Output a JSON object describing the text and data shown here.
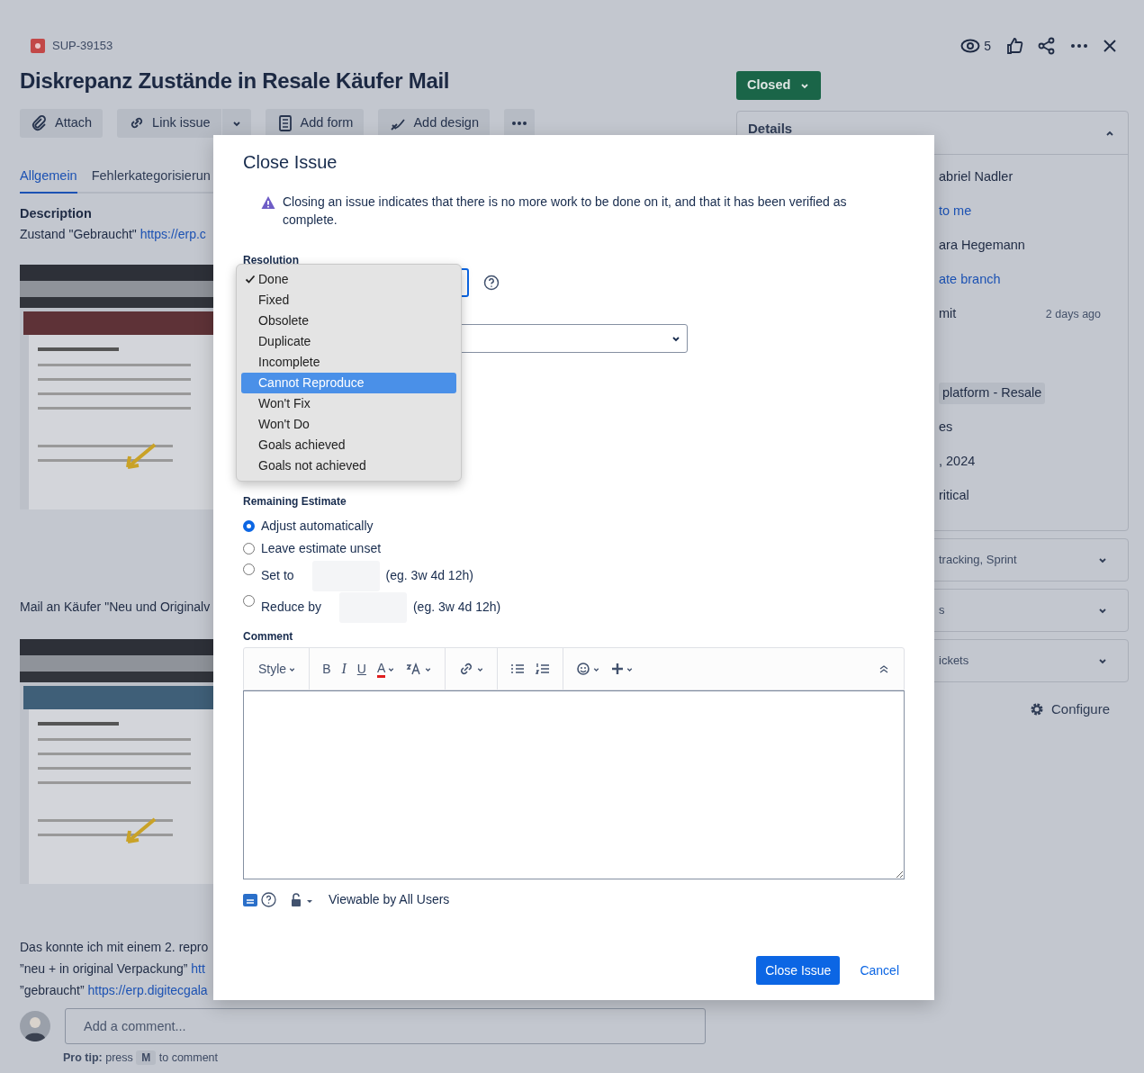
{
  "issue": {
    "key": "SUP-39153",
    "watchers": "5",
    "title": "Diskrepanz Zustände in Resale Käufer Mail",
    "status": "Closed"
  },
  "actions": [
    "Attach",
    "Link issue",
    "Add form",
    "Add design"
  ],
  "tabs": [
    {
      "label": "Allgemein",
      "selected": true
    },
    {
      "label": "Fehlerkategorisierun",
      "selected": false
    }
  ],
  "description": {
    "heading": "Description",
    "content": [
      {
        "kind": "text",
        "text": "Zustand \"Gebraucht\"",
        "link": "https://erp.c"
      },
      {
        "kind": "picture"
      },
      {
        "kind": "text",
        "text": "Mail an Käufer  \"Neu und Originalv"
      },
      {
        "kind": "picture"
      },
      {
        "kind": "text",
        "text": "Das konnte ich mit einem 2. repro"
      },
      {
        "kind": "text",
        "text": "”neu + in original Verpackung”",
        "link": "htt"
      },
      {
        "kind": "text",
        "text": "”gebraucht”",
        "link": "https://erp.digitecgala"
      }
    ]
  },
  "comment_box": {
    "placeholder": "Add a comment...",
    "tip_label": "Pro tip:",
    "tip_text": "press",
    "key": "M",
    "tip_end": "to comment"
  },
  "details": {
    "heading": "Details",
    "rows": [
      {
        "kind": "text",
        "value": "abriel Nadler"
      },
      {
        "kind": "link",
        "value": "to me"
      },
      {
        "kind": "text",
        "value": "ara Hegemann"
      },
      {
        "kind": "link",
        "value": "ate branch"
      },
      {
        "kind": "text",
        "value": "mit",
        "meta": "2 days ago"
      },
      {
        "kind": "tag",
        "value": "platform - Resale"
      },
      {
        "kind": "text",
        "value": "es"
      },
      {
        "kind": "text",
        "value": ", 2024"
      },
      {
        "kind": "text",
        "value": "ritical"
      }
    ],
    "sections": [
      "tracking, Sprint",
      "s",
      "ickets"
    ],
    "configure": "Configure"
  },
  "dialog": {
    "title": "Close Issue",
    "warning": "Closing an issue indicates that there is no more work to be done on it, and that it has been verified as complete.",
    "resolution_label": "Resolution",
    "resolution_options": [
      {
        "label": "Done",
        "selected": true,
        "highlighted": false
      },
      {
        "label": "Fixed",
        "selected": false,
        "highlighted": false
      },
      {
        "label": "Obsolete",
        "selected": false,
        "highlighted": false
      },
      {
        "label": "Duplicate",
        "selected": false,
        "highlighted": false
      },
      {
        "label": "Incomplete",
        "selected": false,
        "highlighted": false
      },
      {
        "label": "Cannot Reproduce",
        "selected": false,
        "highlighted": true
      },
      {
        "label": "Won't Fix",
        "selected": false,
        "highlighted": false
      },
      {
        "label": "Won't Do",
        "selected": false,
        "highlighted": false
      },
      {
        "label": "Goals achieved",
        "selected": false,
        "highlighted": false
      },
      {
        "label": "Goals not achieved",
        "selected": false,
        "highlighted": false
      }
    ],
    "estimate_label": "Remaining Estimate",
    "estimate_options": [
      {
        "kind": "plain",
        "label": "Adjust automatically",
        "selected": true
      },
      {
        "kind": "plain",
        "label": "Leave estimate unset",
        "selected": false
      },
      {
        "kind": "input",
        "label": "Set to",
        "selected": false,
        "hint": "(eg. 3w 4d 12h)"
      },
      {
        "kind": "input",
        "label": "Reduce by",
        "selected": false,
        "hint": "(eg. 3w 4d 12h)"
      }
    ],
    "comment_label": "Comment",
    "editor": {
      "style": "Style",
      "bold": "B",
      "italic": "I",
      "underline": "U",
      "text_color": "A"
    },
    "visibility": "Viewable by All Users",
    "buttons": [
      {
        "kind": "primary",
        "label": "Close Issue"
      },
      {
        "kind": "link",
        "label": "Cancel"
      }
    ]
  }
}
